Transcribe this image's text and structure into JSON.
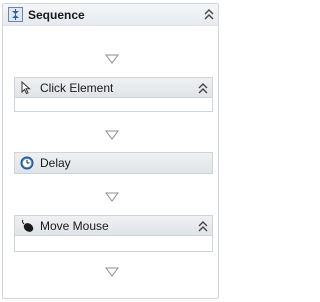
{
  "sequence": {
    "title": "Sequence",
    "icon": "sequence-icon",
    "collapse_icon": "double-chevron-up-icon"
  },
  "activities": [
    {
      "title": "Click Element",
      "icon": "cursor-icon",
      "collapse_icon": "double-chevron-up-icon",
      "expanded": true
    },
    {
      "title": "Delay",
      "icon": "clock-icon",
      "expanded": false
    },
    {
      "title": "Move Mouse",
      "icon": "mouse-icon",
      "collapse_icon": "double-chevron-up-icon",
      "expanded": true
    }
  ],
  "colors": {
    "header_bg": "#e6eaee",
    "border": "#cdd4da",
    "drop_arrow": "#8a8f94"
  }
}
